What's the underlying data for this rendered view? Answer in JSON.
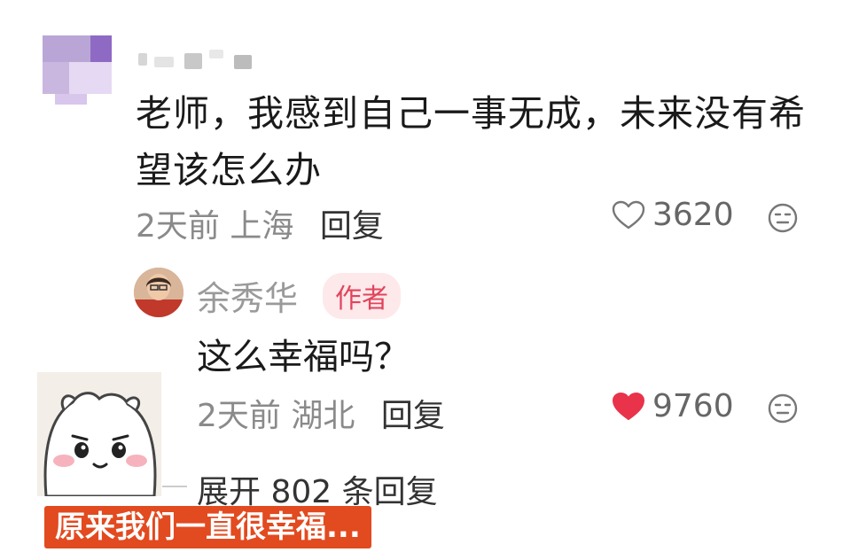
{
  "comment": {
    "text": "老师，我感到自己一事无成，未来没有希望该怎么办",
    "time": "2天前",
    "location": "上海",
    "reply_label": "回复",
    "likes": "3620",
    "liked": false
  },
  "reply": {
    "author_name": "余秀华",
    "author_badge": "作者",
    "text": "这么幸福吗？",
    "time": "2天前",
    "location": "湖北",
    "reply_label": "回复",
    "likes": "9760",
    "liked": true
  },
  "expand_label": "展开 802 条回复",
  "caption": "原来我们一直很幸福...",
  "colors": {
    "like_active": "#e8334a",
    "badge_bg": "#fde8ea",
    "badge_text": "#e0455c",
    "caption_bg": "#e24a1f"
  }
}
